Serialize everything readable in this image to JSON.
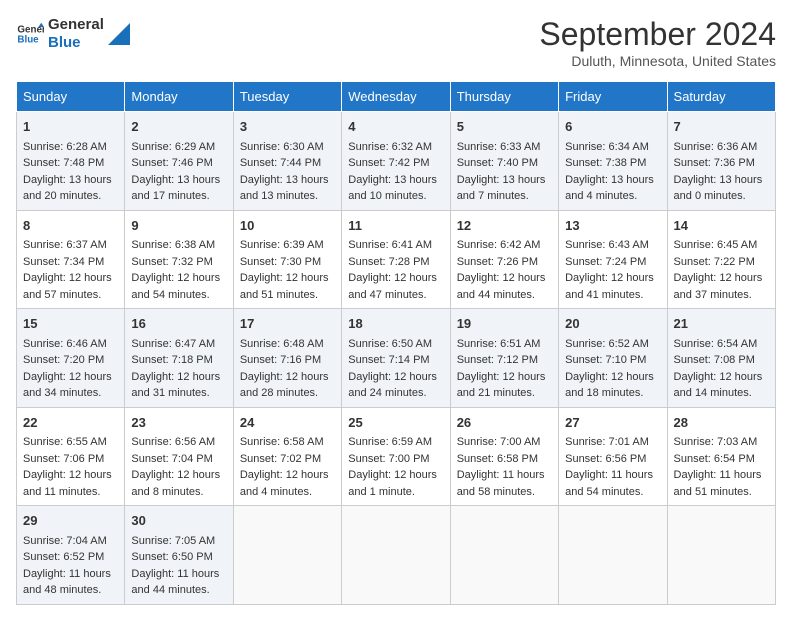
{
  "header": {
    "logo_line1": "General",
    "logo_line2": "Blue",
    "month_title": "September 2024",
    "location": "Duluth, Minnesota, United States"
  },
  "days_of_week": [
    "Sunday",
    "Monday",
    "Tuesday",
    "Wednesday",
    "Thursday",
    "Friday",
    "Saturday"
  ],
  "weeks": [
    [
      {
        "day": "1",
        "sunrise": "6:28 AM",
        "sunset": "7:48 PM",
        "daylight": "13 hours and 20 minutes."
      },
      {
        "day": "2",
        "sunrise": "6:29 AM",
        "sunset": "7:46 PM",
        "daylight": "13 hours and 17 minutes."
      },
      {
        "day": "3",
        "sunrise": "6:30 AM",
        "sunset": "7:44 PM",
        "daylight": "13 hours and 13 minutes."
      },
      {
        "day": "4",
        "sunrise": "6:32 AM",
        "sunset": "7:42 PM",
        "daylight": "13 hours and 10 minutes."
      },
      {
        "day": "5",
        "sunrise": "6:33 AM",
        "sunset": "7:40 PM",
        "daylight": "13 hours and 7 minutes."
      },
      {
        "day": "6",
        "sunrise": "6:34 AM",
        "sunset": "7:38 PM",
        "daylight": "13 hours and 4 minutes."
      },
      {
        "day": "7",
        "sunrise": "6:36 AM",
        "sunset": "7:36 PM",
        "daylight": "13 hours and 0 minutes."
      }
    ],
    [
      {
        "day": "8",
        "sunrise": "6:37 AM",
        "sunset": "7:34 PM",
        "daylight": "12 hours and 57 minutes."
      },
      {
        "day": "9",
        "sunrise": "6:38 AM",
        "sunset": "7:32 PM",
        "daylight": "12 hours and 54 minutes."
      },
      {
        "day": "10",
        "sunrise": "6:39 AM",
        "sunset": "7:30 PM",
        "daylight": "12 hours and 51 minutes."
      },
      {
        "day": "11",
        "sunrise": "6:41 AM",
        "sunset": "7:28 PM",
        "daylight": "12 hours and 47 minutes."
      },
      {
        "day": "12",
        "sunrise": "6:42 AM",
        "sunset": "7:26 PM",
        "daylight": "12 hours and 44 minutes."
      },
      {
        "day": "13",
        "sunrise": "6:43 AM",
        "sunset": "7:24 PM",
        "daylight": "12 hours and 41 minutes."
      },
      {
        "day": "14",
        "sunrise": "6:45 AM",
        "sunset": "7:22 PM",
        "daylight": "12 hours and 37 minutes."
      }
    ],
    [
      {
        "day": "15",
        "sunrise": "6:46 AM",
        "sunset": "7:20 PM",
        "daylight": "12 hours and 34 minutes."
      },
      {
        "day": "16",
        "sunrise": "6:47 AM",
        "sunset": "7:18 PM",
        "daylight": "12 hours and 31 minutes."
      },
      {
        "day": "17",
        "sunrise": "6:48 AM",
        "sunset": "7:16 PM",
        "daylight": "12 hours and 28 minutes."
      },
      {
        "day": "18",
        "sunrise": "6:50 AM",
        "sunset": "7:14 PM",
        "daylight": "12 hours and 24 minutes."
      },
      {
        "day": "19",
        "sunrise": "6:51 AM",
        "sunset": "7:12 PM",
        "daylight": "12 hours and 21 minutes."
      },
      {
        "day": "20",
        "sunrise": "6:52 AM",
        "sunset": "7:10 PM",
        "daylight": "12 hours and 18 minutes."
      },
      {
        "day": "21",
        "sunrise": "6:54 AM",
        "sunset": "7:08 PM",
        "daylight": "12 hours and 14 minutes."
      }
    ],
    [
      {
        "day": "22",
        "sunrise": "6:55 AM",
        "sunset": "7:06 PM",
        "daylight": "12 hours and 11 minutes."
      },
      {
        "day": "23",
        "sunrise": "6:56 AM",
        "sunset": "7:04 PM",
        "daylight": "12 hours and 8 minutes."
      },
      {
        "day": "24",
        "sunrise": "6:58 AM",
        "sunset": "7:02 PM",
        "daylight": "12 hours and 4 minutes."
      },
      {
        "day": "25",
        "sunrise": "6:59 AM",
        "sunset": "7:00 PM",
        "daylight": "12 hours and 1 minute."
      },
      {
        "day": "26",
        "sunrise": "7:00 AM",
        "sunset": "6:58 PM",
        "daylight": "11 hours and 58 minutes."
      },
      {
        "day": "27",
        "sunrise": "7:01 AM",
        "sunset": "6:56 PM",
        "daylight": "11 hours and 54 minutes."
      },
      {
        "day": "28",
        "sunrise": "7:03 AM",
        "sunset": "6:54 PM",
        "daylight": "11 hours and 51 minutes."
      }
    ],
    [
      {
        "day": "29",
        "sunrise": "7:04 AM",
        "sunset": "6:52 PM",
        "daylight": "11 hours and 48 minutes."
      },
      {
        "day": "30",
        "sunrise": "7:05 AM",
        "sunset": "6:50 PM",
        "daylight": "11 hours and 44 minutes."
      },
      null,
      null,
      null,
      null,
      null
    ]
  ]
}
